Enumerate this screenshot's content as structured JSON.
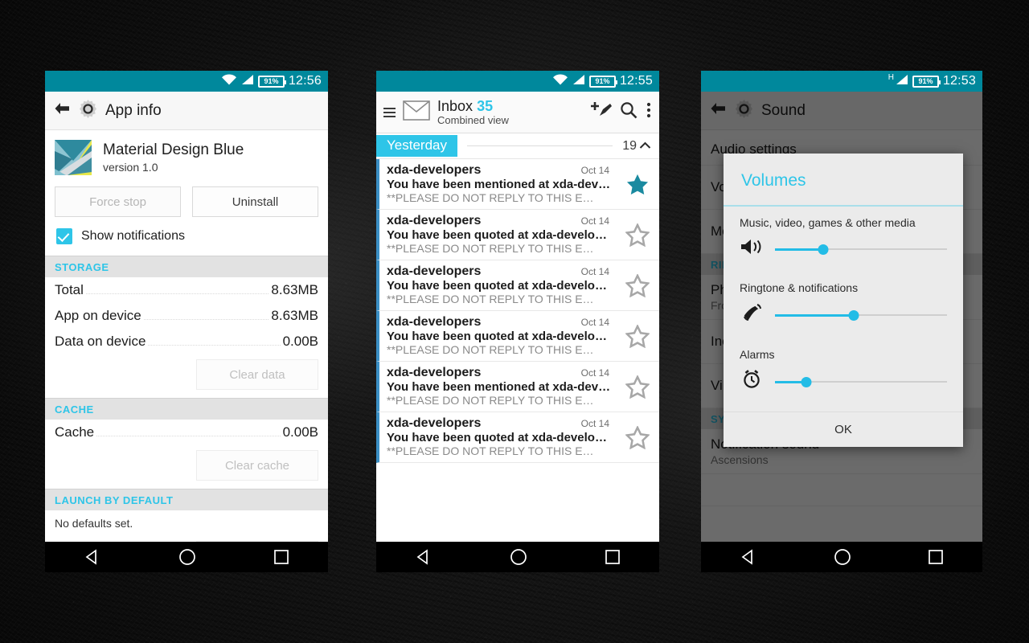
{
  "colors": {
    "status_bar": "#00889c",
    "accent_cyan": "#2ec5e8",
    "slider_cyan": "#23bce6",
    "star_on": "#1a8aa0",
    "mail_edge": "#3b8fc4",
    "dialog_bg": "#ebebeb"
  },
  "phone1": {
    "status": {
      "battery": "91%",
      "clock": "12:56",
      "wifi_icon": "wifi-icon",
      "signal_icon": "signal-icon"
    },
    "actionbar": {
      "back_icon": "back-arrow-icon",
      "app_icon": "settings-gear-icon",
      "title": "App info"
    },
    "app": {
      "icon": "material-design-blue-app-icon",
      "name": "Material Design Blue",
      "version": "version 1.0"
    },
    "buttons": {
      "force_stop": "Force stop",
      "uninstall": "Uninstall"
    },
    "checkbox": {
      "label": "Show notifications",
      "checked": true
    },
    "storage": {
      "header": "STORAGE",
      "rows": [
        {
          "key": "Total",
          "value": "8.63MB"
        },
        {
          "key": "App on device",
          "value": "8.63MB"
        },
        {
          "key": "Data on device",
          "value": "0.00B"
        }
      ],
      "clear_button": "Clear data"
    },
    "cache": {
      "header": "CACHE",
      "rows": [
        {
          "key": "Cache",
          "value": "0.00B"
        }
      ],
      "clear_button": "Clear cache"
    },
    "launch": {
      "header": "LAUNCH BY DEFAULT",
      "text": "No defaults set."
    }
  },
  "phone2": {
    "status": {
      "battery": "91%",
      "clock": "12:55",
      "wifi_icon": "wifi-icon",
      "signal_icon": "signal-icon"
    },
    "actionbar": {
      "menu_icon": "hamburger-menu-icon",
      "mail_icon": "envelope-icon",
      "title": "Inbox",
      "count": "35",
      "subtitle": "Combined view",
      "compose_icon": "compose-pencil-icon",
      "search_icon": "search-icon",
      "overflow_icon": "overflow-menu-icon"
    },
    "datebar": {
      "label": "Yesterday",
      "count": "19",
      "collapse_icon": "chevron-up-icon"
    },
    "mails": [
      {
        "sender": "xda-developers",
        "date": "Oct 14",
        "subject": "You have been mentioned at xda-dev…",
        "preview": "**PLEASE DO NOT REPLY TO THIS E…",
        "starred": true
      },
      {
        "sender": "xda-developers",
        "date": "Oct 14",
        "subject": "You have been quoted at xda-develo…",
        "preview": "**PLEASE DO NOT REPLY TO THIS E…",
        "starred": false
      },
      {
        "sender": "xda-developers",
        "date": "Oct 14",
        "subject": "You have been quoted at xda-develo…",
        "preview": "**PLEASE DO NOT REPLY TO THIS E…",
        "starred": false
      },
      {
        "sender": "xda-developers",
        "date": "Oct 14",
        "subject": "You have been quoted at xda-develo…",
        "preview": "**PLEASE DO NOT REPLY TO THIS E…",
        "starred": false
      },
      {
        "sender": "xda-developers",
        "date": "Oct 14",
        "subject": "You have been mentioned at xda-dev…",
        "preview": "**PLEASE DO NOT REPLY TO THIS E…",
        "starred": false
      },
      {
        "sender": "xda-developers",
        "date": "Oct 14",
        "subject": "You have been quoted at xda-develo…",
        "preview": "**PLEASE DO NOT REPLY TO THIS E…",
        "starred": false
      }
    ]
  },
  "phone3": {
    "status": {
      "battery": "91%",
      "clock": "12:53",
      "signal_icon": "signal-icon",
      "network_label": "H"
    },
    "actionbar": {
      "back_icon": "back-arrow-icon",
      "app_icon": "settings-gear-icon",
      "title": "Sound"
    },
    "background_rows": [
      {
        "type": "item",
        "title": "Audio settings",
        "subtitle": ""
      },
      {
        "type": "item",
        "title": "Volumes",
        "subtitle": ""
      },
      {
        "type": "item",
        "title": "Media",
        "subtitle": ""
      },
      {
        "type": "header",
        "title": "RINGTONE & NOTIFICATIONS",
        "subtitle": ""
      },
      {
        "type": "item",
        "title": "Phone ringtone",
        "subtitle": "From the Mountain"
      },
      {
        "type": "item",
        "title": "Increasing ring",
        "subtitle": ""
      },
      {
        "type": "item",
        "title": "Vibrate when ringing",
        "subtitle": ""
      },
      {
        "type": "header",
        "title": "SYSTEM",
        "subtitle": ""
      }
    ],
    "visible_rows": [
      {
        "title": "Notification sound",
        "subtitle": "Ascensions"
      }
    ],
    "dialog": {
      "title": "Volumes",
      "ok_label": "OK",
      "sliders": [
        {
          "label": "Music, video, games & other media",
          "icon": "speaker-icon",
          "percent": 28
        },
        {
          "label": "Ringtone & notifications",
          "icon": "phone-ring-icon",
          "percent": 46
        },
        {
          "label": "Alarms",
          "icon": "alarm-clock-icon",
          "percent": 18
        }
      ]
    }
  },
  "navbar": {
    "back_icon": "nav-back-triangle-icon",
    "home_icon": "nav-home-circle-icon",
    "recents_icon": "nav-recents-square-icon"
  }
}
